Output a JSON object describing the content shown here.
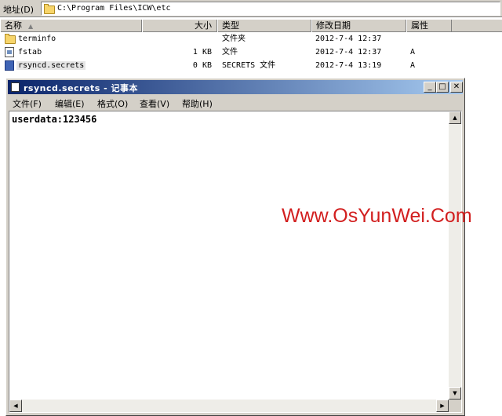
{
  "address_bar": {
    "label": "地址(D)",
    "path": "C:\\Program Files\\ICW\\etc",
    "icon": "folder-icon"
  },
  "list": {
    "columns": [
      {
        "label": "名称"
      },
      {
        "label": "大小"
      },
      {
        "label": "类型"
      },
      {
        "label": "修改日期"
      },
      {
        "label": "属性"
      }
    ],
    "sort_indicator": "▲",
    "rows": [
      {
        "name": "terminfo",
        "size": "",
        "type": "文件夹",
        "modified": "2012-7-4 12:37",
        "attr": "",
        "icon": "folder-icon"
      },
      {
        "name": "fstab",
        "size": "1 KB",
        "type": "文件",
        "modified": "2012-7-4 12:37",
        "attr": "A",
        "icon": "file-icon"
      },
      {
        "name": "rsyncd.secrets",
        "size": "0 KB",
        "type": "SECRETS 文件",
        "modified": "2012-7-4 13:19",
        "attr": "A",
        "icon": "secrets-file-icon"
      }
    ]
  },
  "notepad": {
    "title": "rsyncd.secrets - 记事本",
    "menu": [
      {
        "label": "文件(F)"
      },
      {
        "label": "编辑(E)"
      },
      {
        "label": "格式(O)"
      },
      {
        "label": "查看(V)"
      },
      {
        "label": "帮助(H)"
      }
    ],
    "content": "userdata:123456",
    "buttons": {
      "minimize": "_",
      "maximize": "□",
      "close": "✕"
    }
  },
  "watermark": "Www.OsYunWei.Com"
}
